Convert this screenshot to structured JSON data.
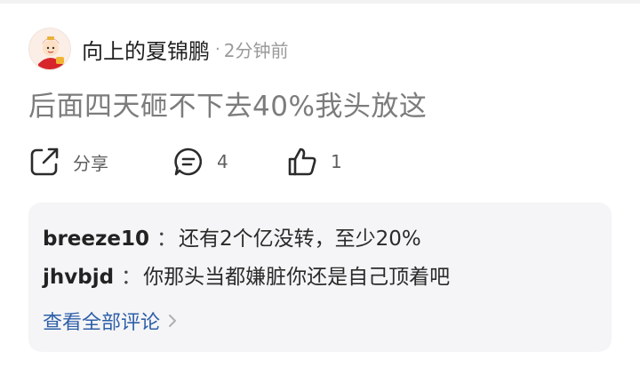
{
  "post": {
    "author": "向上的夏锦鹏",
    "time_separator": "·",
    "time": "2分钟前",
    "body": "后面四天砸不下去40%我头放这"
  },
  "actions": {
    "share_label": "分享",
    "comment_count": "4",
    "like_count": "1"
  },
  "comments": {
    "items": [
      {
        "user": "breeze10",
        "separator": "：",
        "text": "还有2个亿没转，至少20%"
      },
      {
        "user": "jhvbjd",
        "separator": "：",
        "text": "你那头当都嫌脏你还是自己顶着吧"
      }
    ],
    "view_all_label": "查看全部评论"
  },
  "icons": {
    "avatar": "avatar-image",
    "share": "share-icon",
    "comment": "comment-bubble-icon",
    "like": "thumbs-up-icon",
    "chevron": "chevron-right-icon"
  },
  "colors": {
    "link": "#2e5fa8",
    "body_text": "#7c7c7c",
    "meta_text": "#9a9a9a",
    "comments_bg": "#f5f5f7"
  }
}
